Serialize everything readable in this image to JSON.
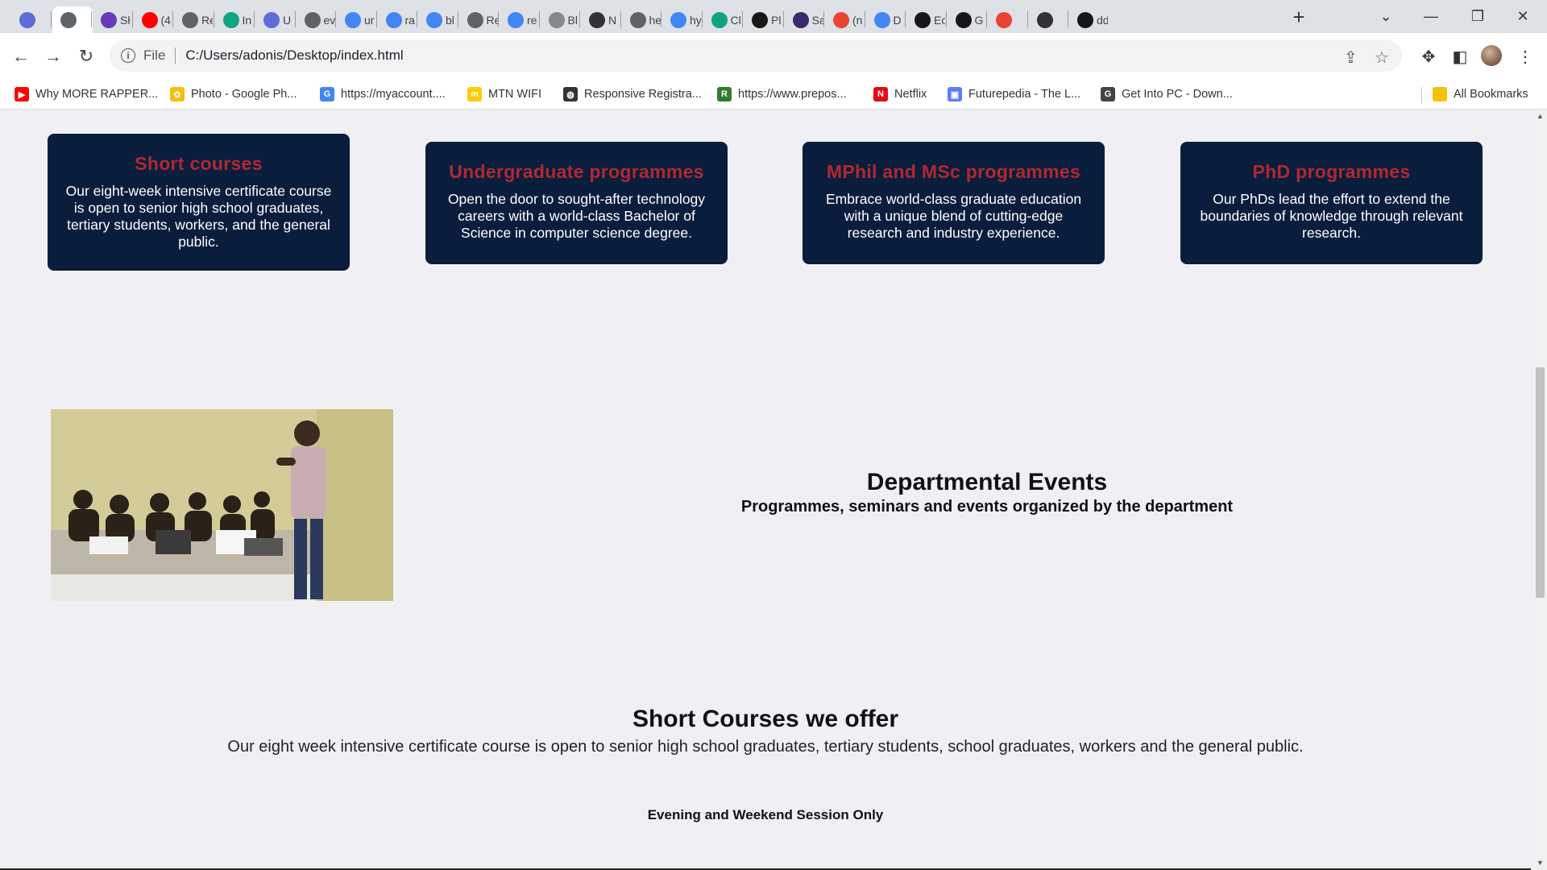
{
  "tabs": [
    {
      "label": "",
      "icon": "purple-grid-icon",
      "color": "#5f6bd6"
    },
    {
      "label": "",
      "icon": "globe-icon",
      "color": "#5f6368",
      "active": true
    },
    {
      "label": "Sł",
      "icon": "list-icon",
      "color": "#673ab7"
    },
    {
      "label": "(4",
      "icon": "youtube-icon",
      "color": "#ff0000"
    },
    {
      "label": "Re",
      "icon": "globe-icon",
      "color": "#5f6368"
    },
    {
      "label": "In",
      "icon": "openai-icon",
      "color": "#10a37f"
    },
    {
      "label": "U",
      "icon": "purple-grid-icon",
      "color": "#5f6bd6"
    },
    {
      "label": "ev",
      "icon": "globe-icon",
      "color": "#5f6368"
    },
    {
      "label": "ur",
      "icon": "google-icon",
      "color": "#4285f4"
    },
    {
      "label": "ra",
      "icon": "google-icon",
      "color": "#4285f4"
    },
    {
      "label": "bl",
      "icon": "google-icon",
      "color": "#4285f4"
    },
    {
      "label": "Re",
      "icon": "globe-icon",
      "color": "#5f6368"
    },
    {
      "label": "re",
      "icon": "google-icon",
      "color": "#4285f4"
    },
    {
      "label": "Bl",
      "icon": "dots-icon",
      "color": "#888888"
    },
    {
      "label": "N",
      "icon": "globe-dark-icon",
      "color": "#333333"
    },
    {
      "label": "he",
      "icon": "globe-icon",
      "color": "#5f6368"
    },
    {
      "label": "hy",
      "icon": "google-icon",
      "color": "#4285f4"
    },
    {
      "label": "Cl",
      "icon": "openai-icon",
      "color": "#10a37f"
    },
    {
      "label": "Pl",
      "icon": "github-icon",
      "color": "#181717"
    },
    {
      "label": "Sa",
      "icon": "crest-icon",
      "color": "#3b2a6b"
    },
    {
      "label": "(n",
      "icon": "gmail-icon",
      "color": "#ea4335"
    },
    {
      "label": "D",
      "icon": "docs-icon",
      "color": "#4285f4"
    },
    {
      "label": "Ec",
      "icon": "github-icon",
      "color": "#181717"
    },
    {
      "label": "G",
      "icon": "github-icon",
      "color": "#181717"
    },
    {
      "label": "",
      "icon": "gmail-icon",
      "color": "#ea4335"
    },
    {
      "label": "",
      "icon": "close-icon",
      "color": "#333333"
    },
    {
      "label": "dd",
      "icon": "github-icon",
      "color": "#181717"
    }
  ],
  "address": {
    "scheme": "File",
    "url": "C:/Users/adonis/Desktop/index.html"
  },
  "bookmarks": [
    {
      "label": "Why MORE RAPPER...",
      "icon": "youtube-icon",
      "color": "#ff0000",
      "glyph": "▶"
    },
    {
      "label": "Photo - Google Ph...",
      "icon": "photos-icon",
      "color": "#fbbc04",
      "glyph": "✿"
    },
    {
      "label": "https://myaccount....",
      "icon": "google-icon",
      "color": "#4285f4",
      "glyph": "G"
    },
    {
      "label": "MTN WIFI",
      "icon": "mtn-icon",
      "color": "#ffcb05",
      "glyph": "m"
    },
    {
      "label": "Responsive Registra...",
      "icon": "globe-icon",
      "color": "#333333",
      "glyph": "◍"
    },
    {
      "label": "https://www.prepos...",
      "icon": "prepostseo-icon",
      "color": "#2e7d32",
      "glyph": "R"
    },
    {
      "label": "Netflix",
      "icon": "netflix-icon",
      "color": "#e50914",
      "glyph": "N"
    },
    {
      "label": "Futurepedia - The L...",
      "icon": "futurepedia-icon",
      "color": "#5c7cfa",
      "glyph": "▣"
    },
    {
      "label": "Get Into PC - Down...",
      "icon": "getintopc-icon",
      "color": "#444444",
      "glyph": "G"
    }
  ],
  "all_bookmarks": "All Bookmarks",
  "cards": [
    {
      "title": "Short courses",
      "text": "Our eight-week intensive certificate course is open to senior high school graduates, tertiary students, workers, and the general public."
    },
    {
      "title": "Undergraduate programmes",
      "text": "Open the door to sought-after technology careers with a world-class Bachelor of Science in computer science degree."
    },
    {
      "title": "MPhil and MSc programmes",
      "text": "Embrace world-class graduate education with a unique blend of cutting-edge research and industry experience."
    },
    {
      "title": "PhD programmes",
      "text": "Our PhDs lead the effort to extend the boundaries of knowledge through relevant research."
    }
  ],
  "events": {
    "title": "Departmental Events",
    "subtitle": "Programmes, seminars and events organized by the department"
  },
  "short_courses": {
    "title": "Short Courses we offer",
    "text": "Our eight week intensive certificate course is open to senior high school graduates, tertiary students, school graduates, workers and the general public.",
    "session": "Evening and Weekend Session Only"
  },
  "colors": {
    "card_bg": "#0a1d3d",
    "card_title": "#b0282f",
    "page_bg": "#f0f0f4"
  }
}
